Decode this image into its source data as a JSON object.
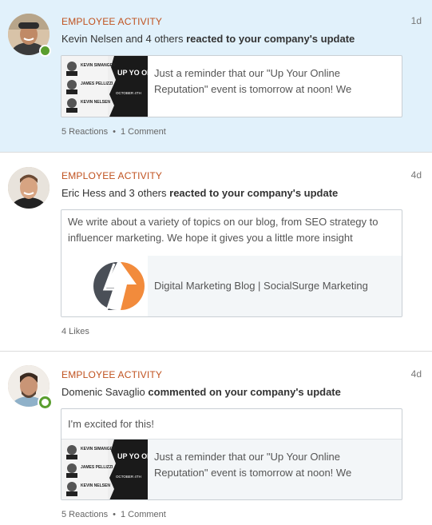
{
  "notifications": [
    {
      "category": "EMPLOYEE ACTIVITY",
      "time": "1d",
      "actor": "Kevin Nelsen and 4 others",
      "action": "reacted to your company's update",
      "share_text": "Just a reminder that our \"Up Your Online Reputation\" event is tomorrow at noon! We",
      "thumb_title": "UP YO ON REPUTA",
      "thumb_names": [
        "KEVIN SIMANGER",
        "JAMES PELLIZZI",
        "KEVIN NELSEN"
      ],
      "thumb_date": "OCTOBER 4TH",
      "stats": {
        "reactions": "5 Reactions",
        "comments": "1 Comment"
      }
    },
    {
      "category": "EMPLOYEE ACTIVITY",
      "time": "4d",
      "actor": "Eric Hess and 3 others",
      "action": "reacted to your company's update",
      "snippet": "We write about a variety of topics on our blog, from SEO strategy to influencer marketing. We hope it gives you a little more insight",
      "link_title": "Digital Marketing Blog | SocialSurge Marketing",
      "stats": {
        "likes": "4 Likes"
      }
    },
    {
      "category": "EMPLOYEE ACTIVITY",
      "time": "4d",
      "actor": "Domenic Savaglio",
      "action": "commented on your company's update",
      "comment": "I'm excited for this!",
      "share_text": "Just a reminder that our \"Up Your Online Reputation\" event is tomorrow at noon! We",
      "thumb_title": "UP YO ON REPUTA",
      "thumb_names": [
        "KEVIN SIMANGER",
        "JAMES PELLIZZI",
        "KEVIN NELSEN"
      ],
      "thumb_date": "OCTOBER 4TH",
      "stats": {
        "reactions": "5 Reactions",
        "comments": "1 Comment"
      }
    }
  ],
  "colors": {
    "unread_bg": "#e1f1fb",
    "category": "#c0521f",
    "presence": "#5a9e2f",
    "logo_orange": "#f28b3c",
    "logo_gray": "#4a4f57"
  }
}
